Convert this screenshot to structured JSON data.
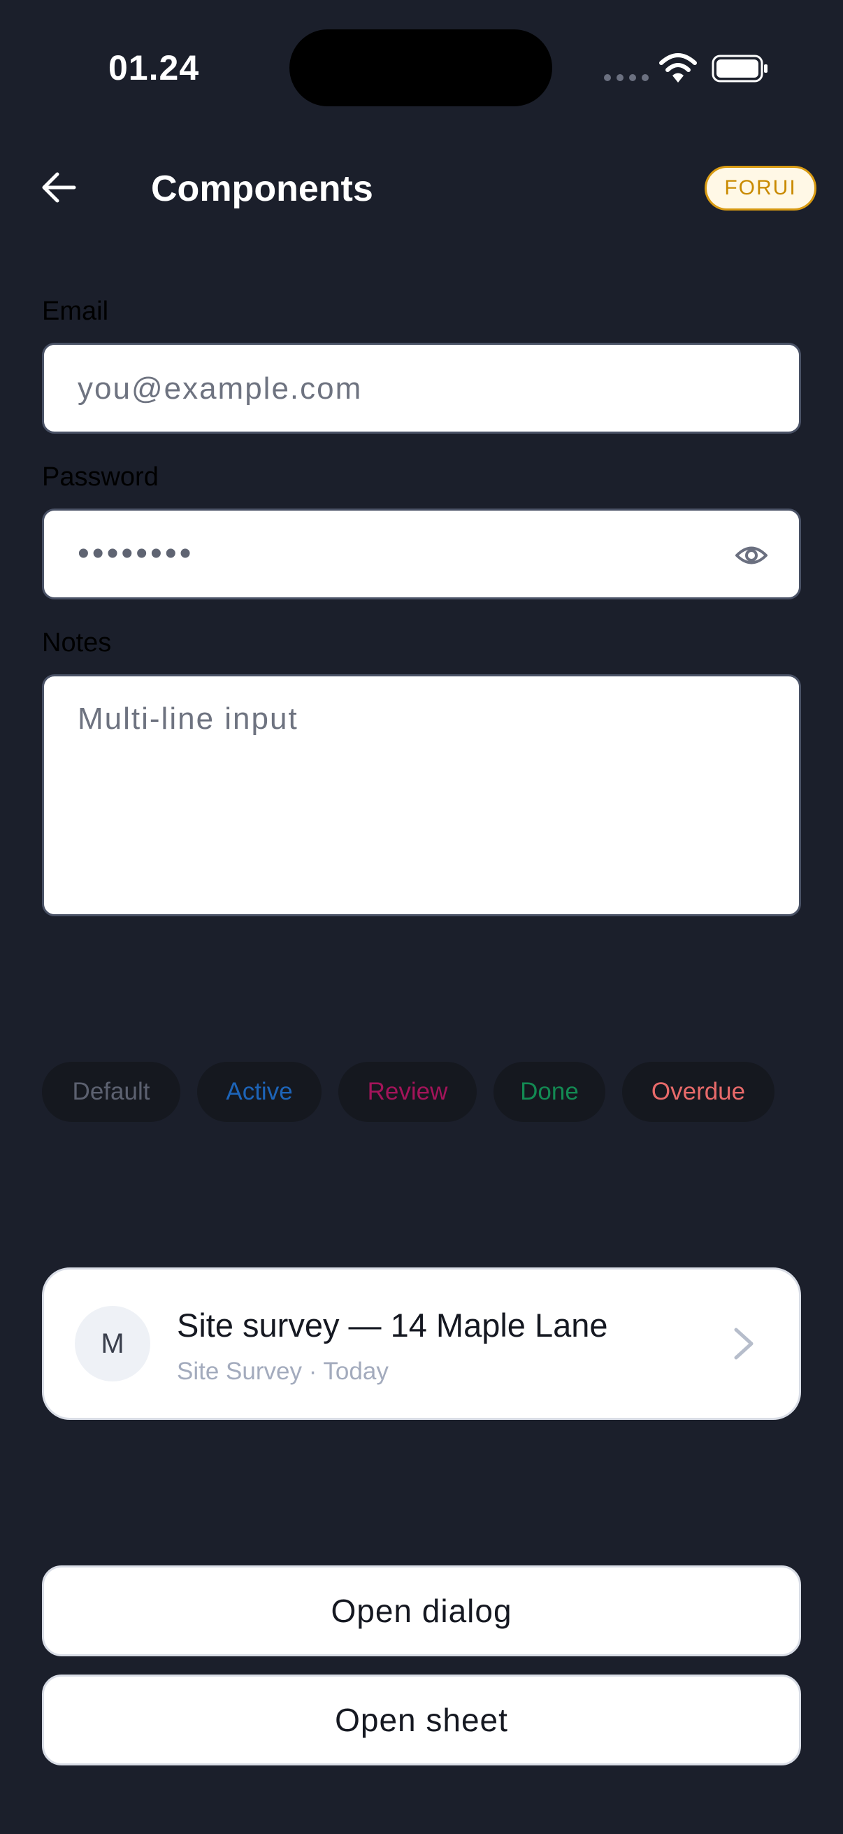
{
  "status_bar": {
    "time": "01.24"
  },
  "nav": {
    "title": "Components",
    "badge": "FORUI"
  },
  "form": {
    "email": {
      "label": "Email",
      "placeholder": "you@example.com"
    },
    "password": {
      "label": "Password",
      "value": "••••••••"
    },
    "notes": {
      "label": "Notes",
      "placeholder": "Multi-line input"
    }
  },
  "chips": [
    {
      "label": "Default",
      "color": "#5c6170"
    },
    {
      "label": "Active",
      "color": "#1d64b8"
    },
    {
      "label": "Review",
      "color": "#a3145a"
    },
    {
      "label": "Done",
      "color": "#138a53"
    },
    {
      "label": "Overdue",
      "color": "#e86a6a"
    }
  ],
  "list_item": {
    "avatar_initial": "M",
    "title": "Site survey — 14 Maple Lane",
    "subtitle": "Site Survey · Today"
  },
  "buttons": {
    "open_dialog": "Open dialog",
    "open_sheet": "Open sheet"
  },
  "colors": {
    "background": "#1b1f2b",
    "accent": "#d89a12"
  }
}
